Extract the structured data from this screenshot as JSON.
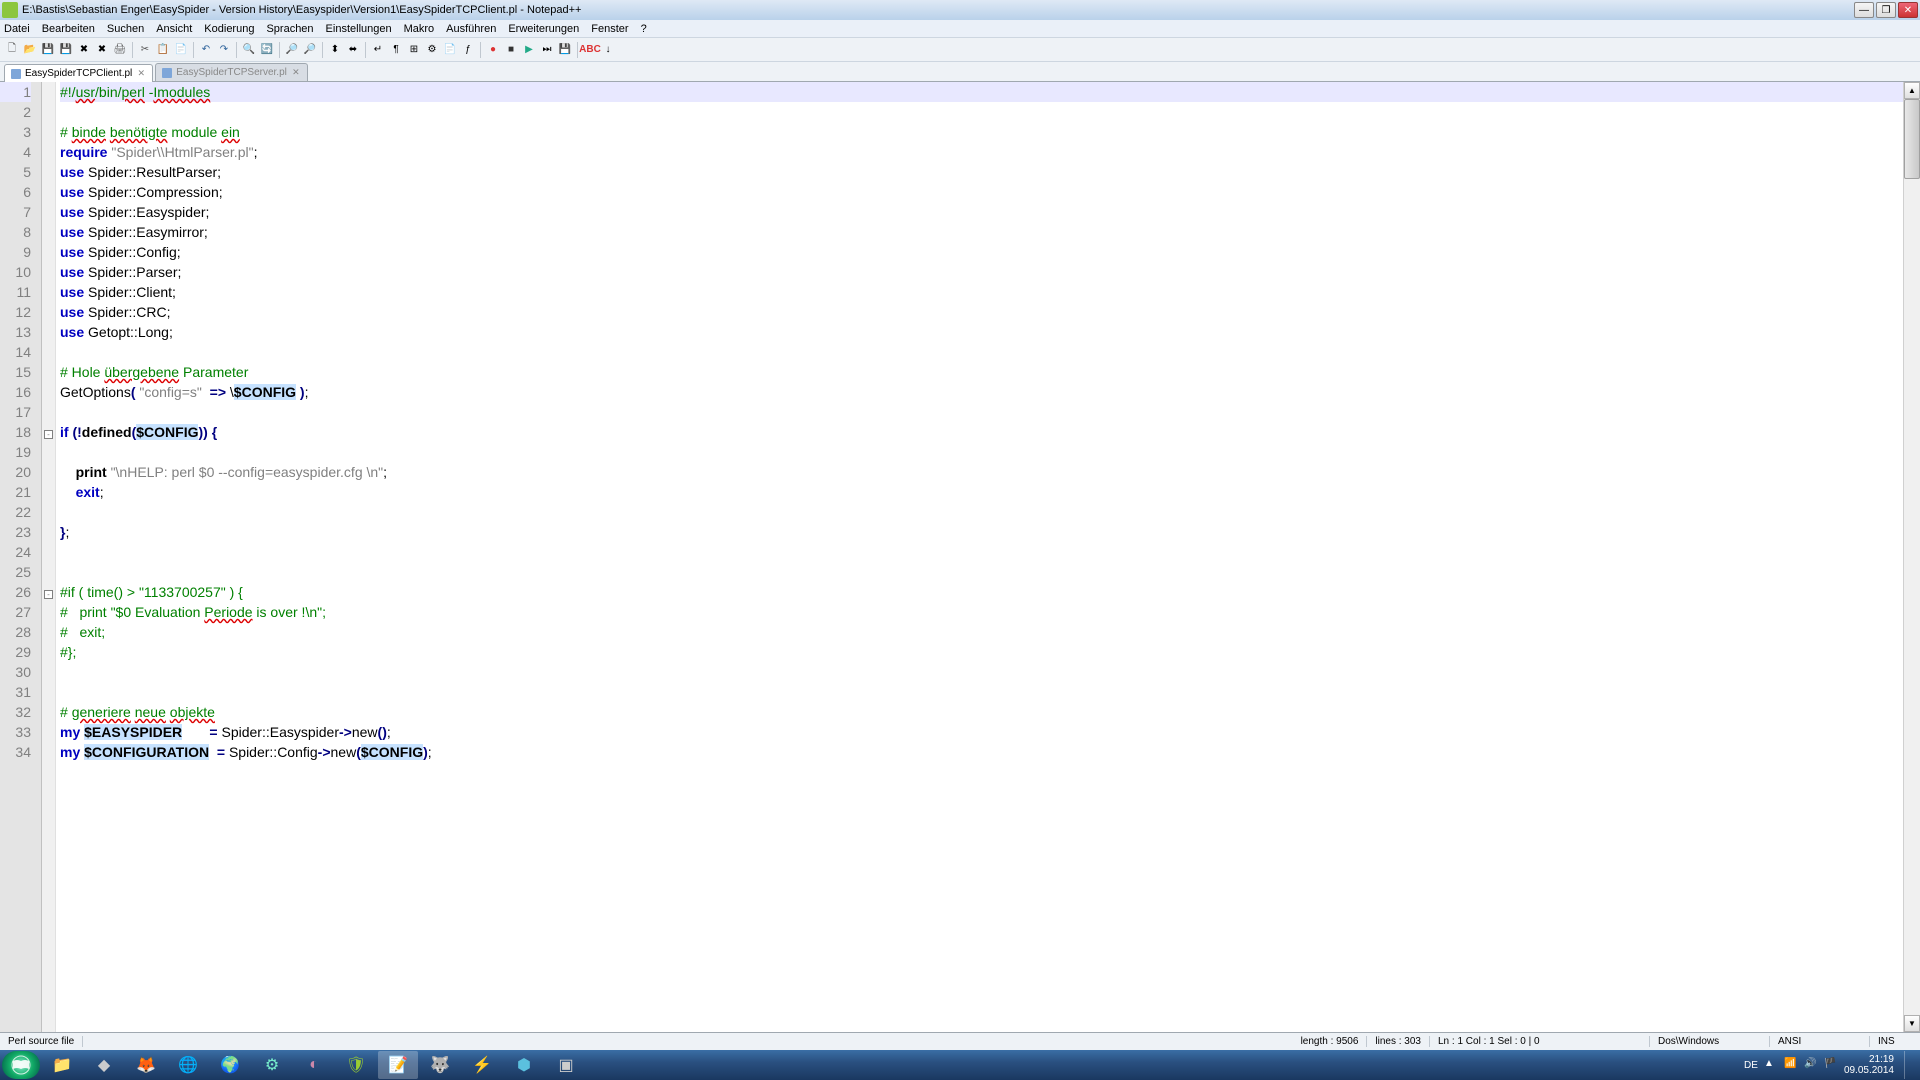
{
  "window": {
    "title": "E:\\Bastis\\Sebastian Enger\\EasySpider - Version History\\Easyspider\\Version1\\EasySpiderTCPClient.pl - Notepad++"
  },
  "menu": {
    "items": [
      "Datei",
      "Bearbeiten",
      "Suchen",
      "Ansicht",
      "Kodierung",
      "Sprachen",
      "Einstellungen",
      "Makro",
      "Ausführen",
      "Erweiterungen",
      "Fenster",
      "?"
    ]
  },
  "tabs": [
    {
      "label": "EasySpiderTCPClient.pl",
      "active": true
    },
    {
      "label": "EasySpiderTCPServer.pl",
      "active": false
    }
  ],
  "code_lines": [
    {
      "n": 1,
      "current": true,
      "tokens": [
        [
          "cmt",
          "#!/"
        ],
        [
          "cmt wavy",
          "usr"
        ],
        [
          "cmt",
          "/bin/"
        ],
        [
          "cmt wavy",
          "perl"
        ],
        [
          "cmt",
          " -"
        ],
        [
          "cmt wavy",
          "Imodules"
        ]
      ]
    },
    {
      "n": 2,
      "tokens": []
    },
    {
      "n": 3,
      "tokens": [
        [
          "cmt",
          "# "
        ],
        [
          "cmt wavy",
          "binde"
        ],
        [
          "cmt",
          " "
        ],
        [
          "cmt wavy",
          "benötigte"
        ],
        [
          "cmt",
          " module "
        ],
        [
          "cmt wavy",
          "ein"
        ]
      ]
    },
    {
      "n": 4,
      "tokens": [
        [
          "kw",
          "require"
        ],
        [
          "",
          ""
        ],
        [
          "str",
          " \"Spider\\\\HtmlParser.pl\""
        ],
        [
          "punct",
          ";"
        ]
      ]
    },
    {
      "n": 5,
      "tokens": [
        [
          "kw",
          "use"
        ],
        [
          "",
          " Spider::ResultParser;"
        ]
      ]
    },
    {
      "n": 6,
      "tokens": [
        [
          "kw",
          "use"
        ],
        [
          "",
          " Spider::Compression;"
        ]
      ]
    },
    {
      "n": 7,
      "tokens": [
        [
          "kw",
          "use"
        ],
        [
          "",
          " Spider::Easyspider;"
        ]
      ]
    },
    {
      "n": 8,
      "tokens": [
        [
          "kw",
          "use"
        ],
        [
          "",
          " Spider::Easymirror;"
        ]
      ]
    },
    {
      "n": 9,
      "tokens": [
        [
          "kw",
          "use"
        ],
        [
          "",
          " Spider::Config;"
        ]
      ]
    },
    {
      "n": 10,
      "tokens": [
        [
          "kw",
          "use"
        ],
        [
          "",
          " Spider::Parser;"
        ]
      ]
    },
    {
      "n": 11,
      "tokens": [
        [
          "kw",
          "use"
        ],
        [
          "",
          " Spider::Client;"
        ]
      ]
    },
    {
      "n": 12,
      "tokens": [
        [
          "kw",
          "use"
        ],
        [
          "",
          " Spider::CRC;"
        ]
      ]
    },
    {
      "n": 13,
      "tokens": [
        [
          "kw",
          "use"
        ],
        [
          "",
          " Getopt::Long;"
        ]
      ]
    },
    {
      "n": 14,
      "tokens": []
    },
    {
      "n": 15,
      "tokens": [
        [
          "cmt",
          "# Hole "
        ],
        [
          "cmt wavy",
          "übergebene"
        ],
        [
          "cmt",
          " Parameter"
        ]
      ]
    },
    {
      "n": 16,
      "tokens": [
        [
          "",
          "GetOptions"
        ],
        [
          "op",
          "("
        ],
        [
          "",
          " "
        ],
        [
          "str",
          "\"config=s\""
        ],
        [
          "",
          "  "
        ],
        [
          "op",
          "=>"
        ],
        [
          "",
          " \\"
        ],
        [
          "varh",
          "$CONFIG"
        ],
        [
          "",
          " "
        ],
        [
          "op",
          ")"
        ],
        [
          "punct",
          ";"
        ]
      ]
    },
    {
      "n": 17,
      "tokens": []
    },
    {
      "n": 18,
      "fold": "-",
      "tokens": [
        [
          "kw",
          "if"
        ],
        [
          "",
          " "
        ],
        [
          "op",
          "("
        ],
        [
          "op",
          "!"
        ],
        [
          "func",
          "defined"
        ],
        [
          "op",
          "("
        ],
        [
          "varh",
          "$CONFIG"
        ],
        [
          "op",
          "))"
        ],
        [
          "",
          " "
        ],
        [
          "op",
          "{"
        ]
      ]
    },
    {
      "n": 19,
      "tokens": []
    },
    {
      "n": 20,
      "tokens": [
        [
          "",
          "    "
        ],
        [
          "func",
          "print"
        ],
        [
          "",
          " "
        ],
        [
          "str",
          "\"\\nHELP: perl $0 --config=easyspider.cfg \\n\""
        ],
        [
          "punct",
          ";"
        ]
      ]
    },
    {
      "n": 21,
      "tokens": [
        [
          "",
          "    "
        ],
        [
          "kw",
          "exit"
        ],
        [
          "punct",
          ";"
        ]
      ]
    },
    {
      "n": 22,
      "tokens": []
    },
    {
      "n": 23,
      "tokens": [
        [
          "op",
          "}"
        ],
        [
          "punct",
          ";"
        ]
      ]
    },
    {
      "n": 24,
      "tokens": []
    },
    {
      "n": 25,
      "tokens": []
    },
    {
      "n": 26,
      "fold": "-",
      "tokens": [
        [
          "cmt",
          "#if ( time() > \"1133700257\" ) {"
        ]
      ]
    },
    {
      "n": 27,
      "tokens": [
        [
          "cmt",
          "#   print \"$0 Evaluation "
        ],
        [
          "cmt wavy",
          "Periode"
        ],
        [
          "cmt",
          " is over !\\n\";"
        ]
      ]
    },
    {
      "n": 28,
      "tokens": [
        [
          "cmt",
          "#   exit;"
        ]
      ]
    },
    {
      "n": 29,
      "tokens": [
        [
          "cmt",
          "#};"
        ]
      ]
    },
    {
      "n": 30,
      "tokens": []
    },
    {
      "n": 31,
      "tokens": []
    },
    {
      "n": 32,
      "tokens": [
        [
          "cmt",
          "# "
        ],
        [
          "cmt wavy",
          "generiere"
        ],
        [
          "cmt",
          " "
        ],
        [
          "cmt wavy",
          "neue"
        ],
        [
          "cmt",
          " "
        ],
        [
          "cmt wavy",
          "objekte"
        ]
      ]
    },
    {
      "n": 33,
      "tokens": [
        [
          "kw",
          "my"
        ],
        [
          "",
          " "
        ],
        [
          "varh",
          "$EASYSPIDER"
        ],
        [
          "",
          "       "
        ],
        [
          "op",
          "="
        ],
        [
          "",
          " Spider::Easyspider"
        ],
        [
          "op",
          "->"
        ],
        [
          "",
          "new"
        ],
        [
          "op",
          "()"
        ],
        [
          "punct",
          ";"
        ]
      ]
    },
    {
      "n": 34,
      "tokens": [
        [
          "kw",
          "my"
        ],
        [
          "",
          " "
        ],
        [
          "varh",
          "$CONFIGURATION"
        ],
        [
          "",
          "  "
        ],
        [
          "op",
          "="
        ],
        [
          "",
          " Spider::Config"
        ],
        [
          "op",
          "->"
        ],
        [
          "",
          "new"
        ],
        [
          "op",
          "("
        ],
        [
          "varh",
          "$CONFIG"
        ],
        [
          "op",
          ")"
        ],
        [
          "punct",
          ";"
        ]
      ]
    }
  ],
  "status": {
    "type": "Perl source file",
    "length": "length : 9506",
    "lines": "lines : 303",
    "pos": "Ln : 1   Col : 1   Sel : 0 | 0",
    "eol": "Dos\\Windows",
    "enc": "ANSI",
    "ins": "INS"
  },
  "tray": {
    "lang": "DE",
    "time": "21:19",
    "date": "09.05.2014"
  }
}
